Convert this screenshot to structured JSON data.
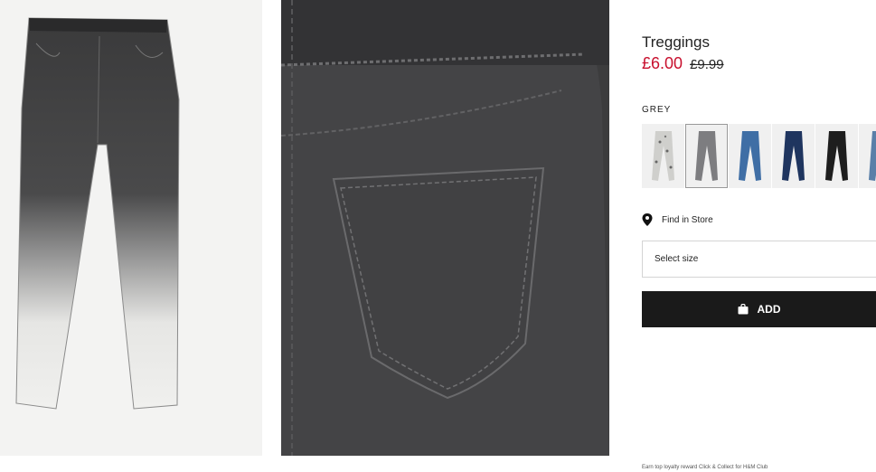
{
  "product": {
    "title": "Treggings",
    "price_now": "£6.00",
    "price_old": "£9.99",
    "color_label": "GREY",
    "swatches": [
      {
        "name": "leopard-print",
        "selected": false
      },
      {
        "name": "grey",
        "selected": true
      },
      {
        "name": "mid-blue",
        "selected": false
      },
      {
        "name": "dark-blue",
        "selected": false
      },
      {
        "name": "black",
        "selected": false
      },
      {
        "name": "light-blue",
        "selected": false
      }
    ]
  },
  "find_store": {
    "label": "Find in Store",
    "icon": "location-pin-icon"
  },
  "size_select": {
    "label": "Select size"
  },
  "add_button": {
    "label": "ADD",
    "icon": "shopping-bag-icon"
  },
  "footer": {
    "text": "Earn top loyalty reward Click & Collect for H&M Club"
  },
  "colors": {
    "price_sale": "#c8102e",
    "add_button_bg": "#1a1a1a"
  }
}
